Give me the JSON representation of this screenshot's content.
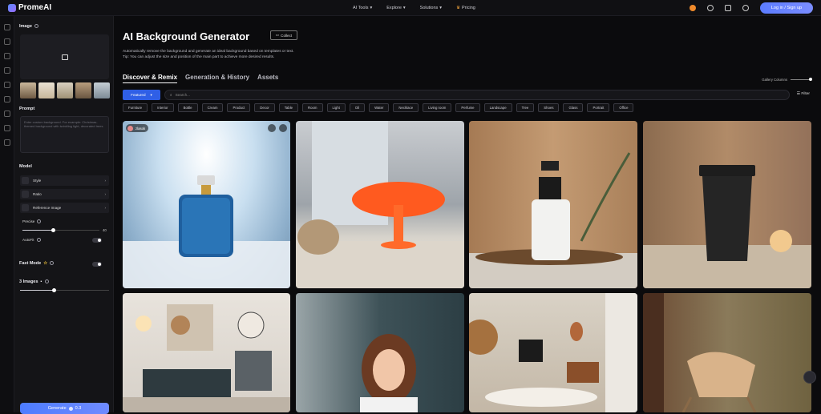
{
  "header": {
    "logo": "PromeAI",
    "nav": [
      "AI Tools",
      "Explore",
      "Solutions",
      "Pricing"
    ],
    "login": "Log in / Sign up"
  },
  "sidebar": {
    "image_label": "Image",
    "prompt_label": "Prompt",
    "prompt_placeholder": "Enter custom background. For example: Christmas-themed background with twinkling light, decorated trees",
    "model_label": "Model",
    "model_rows": [
      "Style",
      "Ratio",
      "Reference Image"
    ],
    "precise_label": "Precise",
    "precise_value": "40",
    "autofit_label": "AutoFit",
    "fast_mode_label": "Fast Mode",
    "images_label": "3 Images",
    "generate_label": "Generate",
    "generate_cost": "0.3"
  },
  "main": {
    "title": "AI Background Generator",
    "collect": "Collect",
    "desc_line1": "Automatically remove the background and generate an ideal background based on templates or text.",
    "desc_line2": "Tip: You can adjust the size and position of the main part to achieve more desired results.",
    "tabs": [
      "Discover & Remix",
      "Generation & History",
      "Assets"
    ],
    "gallery_columns": "Gallery Columns",
    "featured": "Featured",
    "search_placeholder": "Search...",
    "filter": "Filter",
    "chips": [
      "Furniture",
      "Interior",
      "Bottle",
      "Cream",
      "Product",
      "Decor",
      "Table",
      "Room",
      "Light",
      "Oil",
      "Water",
      "Necklace",
      "Living room",
      "Perfume",
      "Landscape",
      "Tree",
      "Shoes",
      "Glass",
      "Portrait",
      "Office"
    ],
    "first_card_user": "zlasok"
  }
}
